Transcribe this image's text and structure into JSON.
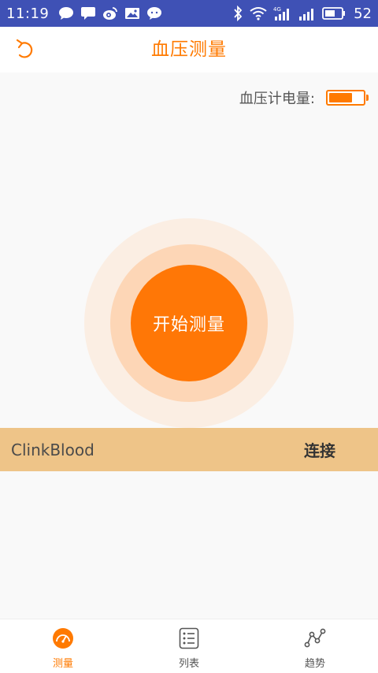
{
  "status_bar": {
    "time": "11:19",
    "battery": "52",
    "icons_left": [
      "chat-bubble-icon",
      "message-icon",
      "weibo-icon",
      "image-icon",
      "wechat-icon"
    ],
    "icons_right": [
      "bluetooth-icon",
      "wifi-icon",
      "signal-4g-icon",
      "signal-icon",
      "battery-icon"
    ]
  },
  "header": {
    "title": "血压测量",
    "back_icon": "back-arrow-icon"
  },
  "battery": {
    "label": "血压计电量:",
    "level_fraction": 0.7,
    "color": "#ff7a00"
  },
  "measure": {
    "button_label": "开始测量",
    "color": "#ff7706"
  },
  "device": {
    "name": "ClinkBlood",
    "connect_label": "连接",
    "row_color": "#eec488"
  },
  "bottom_nav": {
    "items": [
      {
        "label": "测量",
        "icon": "gauge-icon",
        "active": true
      },
      {
        "label": "列表",
        "icon": "list-icon",
        "active": false
      },
      {
        "label": "趋势",
        "icon": "trend-icon",
        "active": false
      }
    ],
    "accent": "#ff7a00"
  }
}
